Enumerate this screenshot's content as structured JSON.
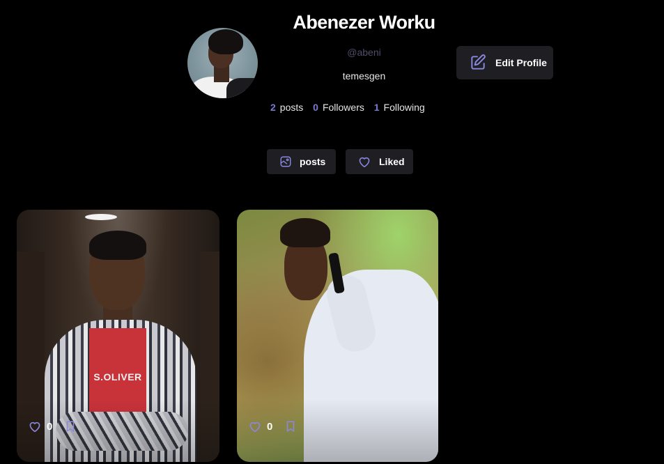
{
  "profile": {
    "name": "Abenezer Worku",
    "handle": "@abeni",
    "bio": "temesgen",
    "edit_label": "Edit Profile"
  },
  "stats": {
    "posts_count": "2",
    "posts_label": "posts",
    "followers_count": "0",
    "followers_label": "Followers",
    "following_count": "1",
    "following_label": "Following"
  },
  "tabs": {
    "posts_label": "posts",
    "liked_label": "Liked"
  },
  "posts": [
    {
      "likes": "0",
      "tee_text": "S.OLIVER"
    },
    {
      "likes": "0"
    }
  ],
  "colors": {
    "background": "#000000",
    "surface": "#1f1f23",
    "accent": "#7b7ad0",
    "muted": "#4f4d6a"
  },
  "icons": {
    "edit": "pencil-square-icon",
    "posts_tab": "image-icon",
    "liked_tab": "heart-icon",
    "like": "heart-icon",
    "save": "bookmark-icon"
  }
}
